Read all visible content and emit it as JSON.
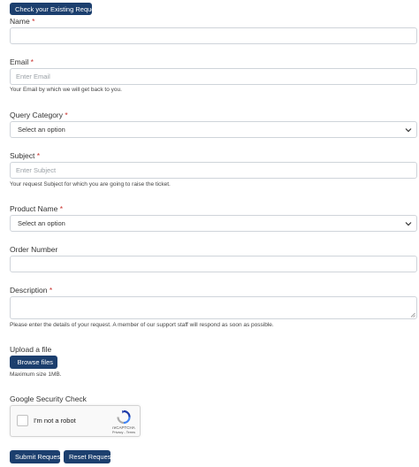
{
  "header": {
    "check_request_label": "Check your Existing Request"
  },
  "fields": {
    "name": {
      "label": "Name",
      "required_mark": "*"
    },
    "email": {
      "label": "Email",
      "required_mark": "*",
      "placeholder": "Enter Email",
      "help": "Your Email by which we will get back to you."
    },
    "query_category": {
      "label": "Query Category",
      "required_mark": "*",
      "selected": "Select an option"
    },
    "subject": {
      "label": "Subject",
      "required_mark": "*",
      "placeholder": "Enter Subject",
      "help": "Your request Subject for which you are going to raise the ticket."
    },
    "product_name": {
      "label": "Product Name",
      "required_mark": "*",
      "selected": "Select an option"
    },
    "order_number": {
      "label": "Order Number"
    },
    "description": {
      "label": "Description",
      "required_mark": "*",
      "help": "Please enter the details of your request. A member of our support staff will respond as soon as possible."
    }
  },
  "upload": {
    "label": "Upload a file",
    "button_label": "Browse files",
    "help": "Maximum size 1MB."
  },
  "security": {
    "label": "Google Security Check",
    "captcha_text": "I'm not a robot",
    "captcha_brand": "reCAPTCHA",
    "captcha_links": "Privacy - Terms"
  },
  "actions": {
    "submit_label": "Submit Request",
    "reset_label": "Reset Request"
  },
  "colors": {
    "primary": "#1c3f6e",
    "required": "#c9302c",
    "border": "#cfd4da"
  }
}
